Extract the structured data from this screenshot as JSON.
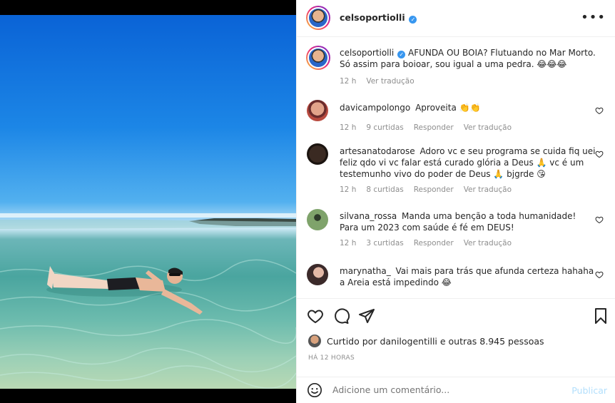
{
  "post": {
    "username": "celsoportiolli",
    "caption": "AFUNDA OU BOIA? Flutuando no Mar Morto. Só assim para boioar, sou igual a uma pedra. 😂😂😂",
    "caption_time": "12 h",
    "caption_translate": "Ver tradução"
  },
  "comments": [
    {
      "user": "davicampolongo",
      "text": "Aproveita 👏👏",
      "time": "12 h",
      "likes": "9 curtidas",
      "reply": "Responder",
      "translate": "Ver tradução"
    },
    {
      "user": "artesanatodarose",
      "text": "Adoro vc e seu programa se cuida fiq uei feliz qdo vi vc falar está curado glória a Deus 🙏 vc é um testemunho vivo do poder de Deus 🙏 bjgrde 😘",
      "time": "12 h",
      "likes": "8 curtidas",
      "reply": "Responder",
      "translate": "Ver tradução"
    },
    {
      "user": "silvana_rossa",
      "text": "Manda uma benção a toda humanidade! Para um 2023 com saúde é fé em DEUS!",
      "time": "12 h",
      "likes": "3 curtidas",
      "reply": "Responder",
      "translate": "Ver tradução"
    },
    {
      "user": "marynatha_",
      "text": "Vai mais para trás que afunda certeza hahaha a Areia está impedindo 😂",
      "time": "",
      "likes": "",
      "reply": "",
      "translate": ""
    }
  ],
  "likes_line": {
    "prefix": "Curtido por",
    "user": "danilogentilli",
    "suffix": "e outras 8.945 pessoas"
  },
  "timestamp": "HÁ 12 HORAS",
  "add_comment": {
    "placeholder": "Adicione um comentário...",
    "publish": "Publicar"
  },
  "icons": [
    "more-options-icon",
    "heart-icon",
    "comment-icon",
    "share-icon",
    "bookmark-icon",
    "emoji-icon",
    "verified-icon"
  ],
  "colors": {
    "link_blue": "#3897f0",
    "publish_disabled": "#b2dffc",
    "meta_gray": "#8e8e8e"
  }
}
